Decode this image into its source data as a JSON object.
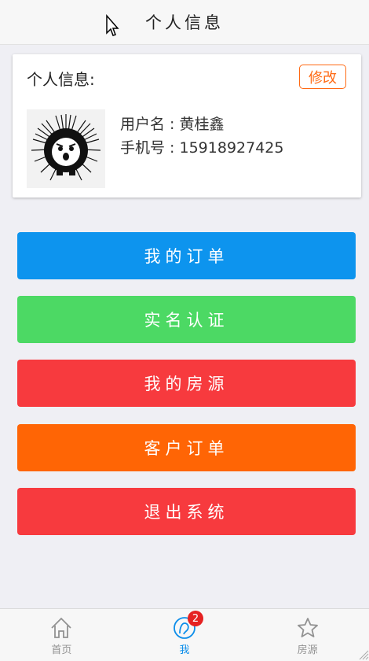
{
  "header": {
    "title": "个人信息"
  },
  "profile": {
    "section_title": "个人信息:",
    "edit_label": "修改",
    "username_label": "用户名 :",
    "username": "黄桂鑫",
    "phone_label": "手机号 :",
    "phone": "15918927425"
  },
  "menu": [
    {
      "label": "我的订单",
      "color": "#0d94ee"
    },
    {
      "label": "实名认证",
      "color": "#4cd964"
    },
    {
      "label": "我的房源",
      "color": "#f73a3e"
    },
    {
      "label": "客户订单",
      "color": "#ff6505"
    },
    {
      "label": "退出系统",
      "color": "#f73a3e"
    }
  ],
  "tabbar": {
    "items": [
      {
        "label": "首页",
        "icon": "home-icon"
      },
      {
        "label": "我",
        "icon": "user-icon",
        "badge": "2",
        "active": true
      },
      {
        "label": "房源",
        "icon": "star-icon"
      }
    ]
  }
}
